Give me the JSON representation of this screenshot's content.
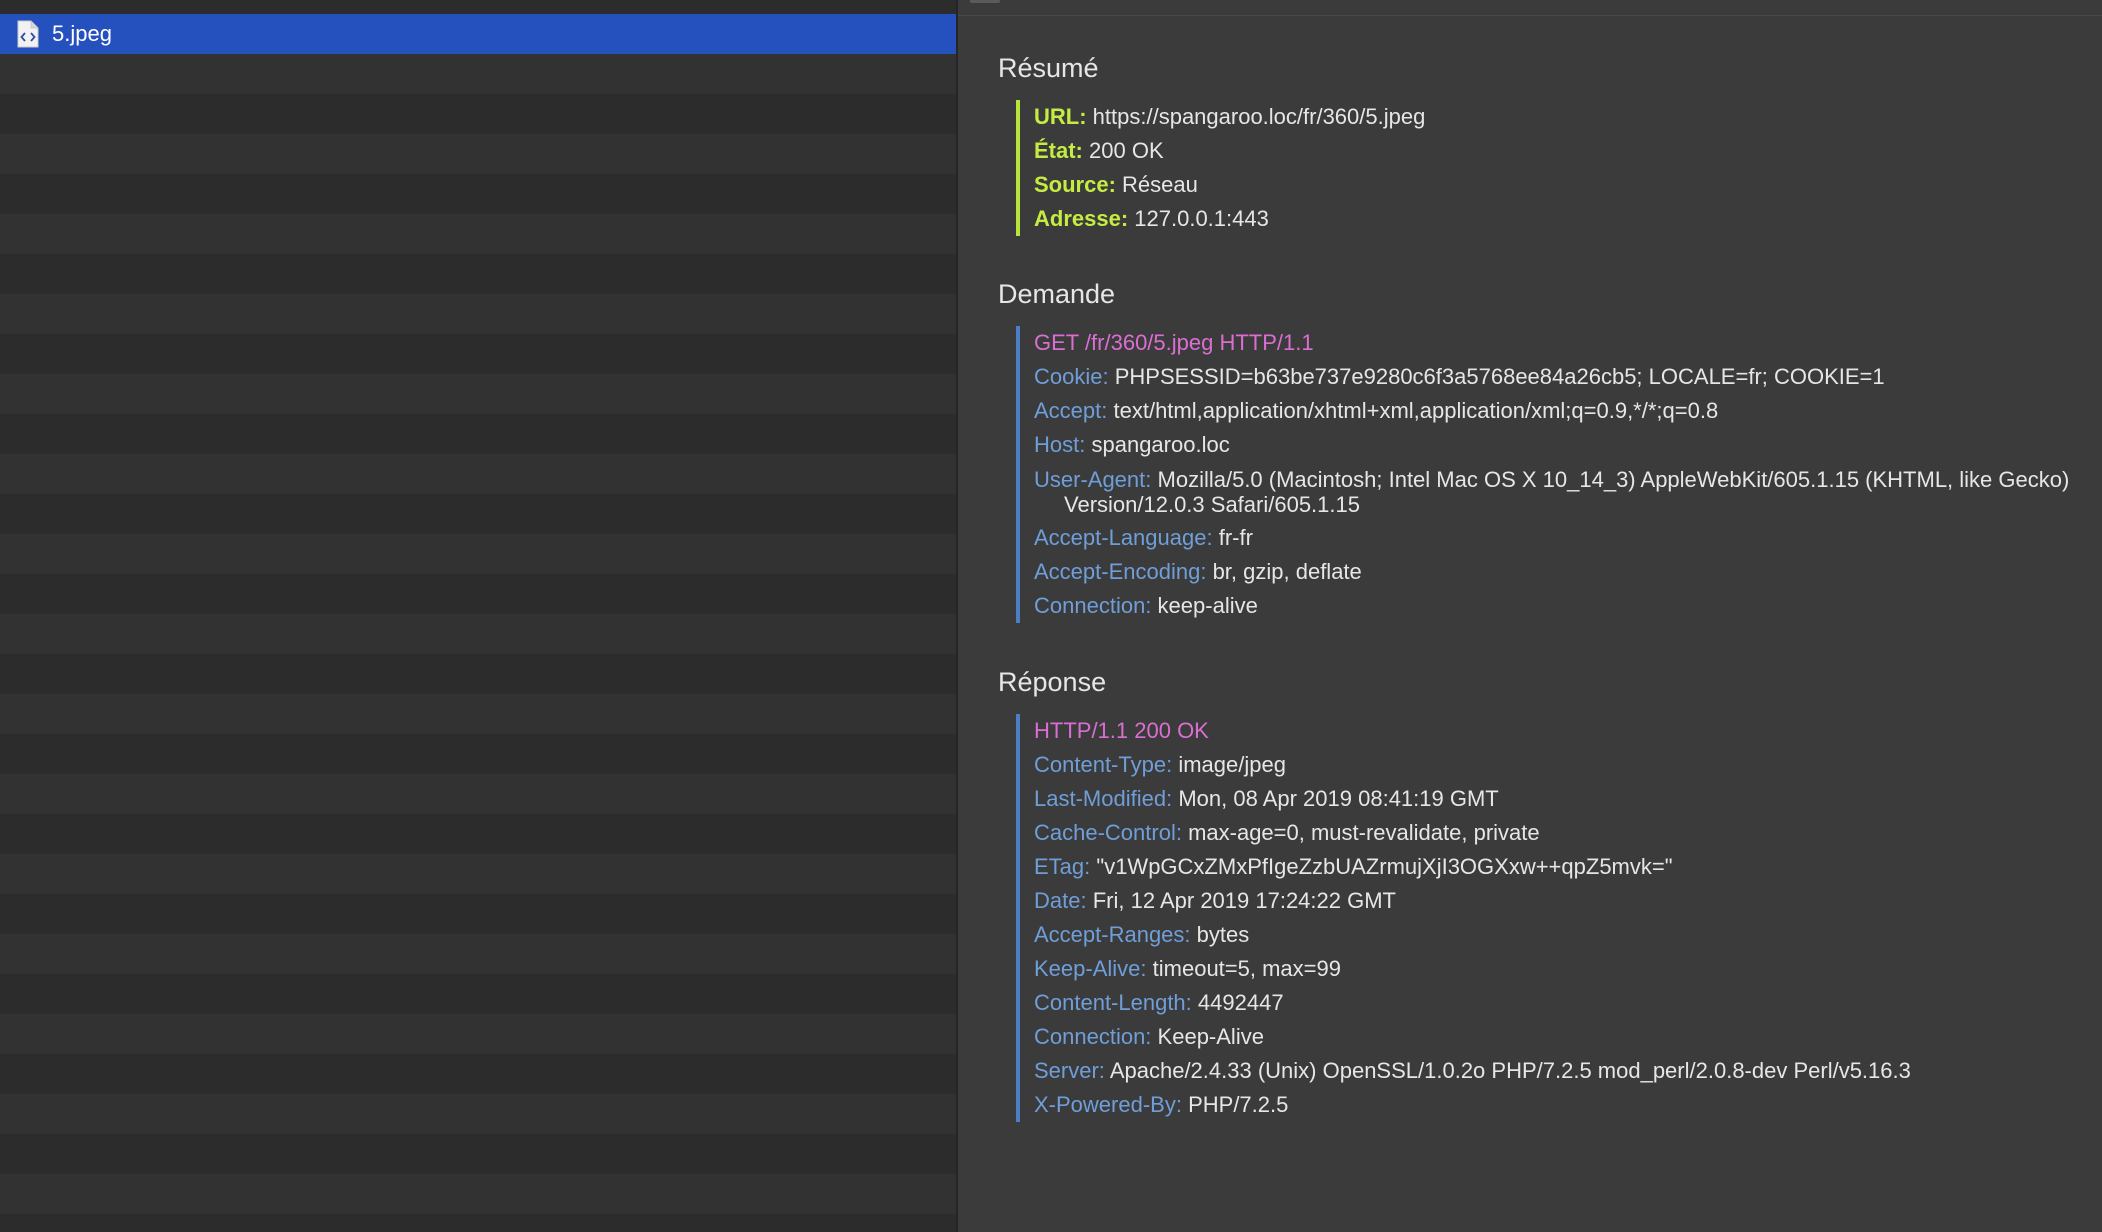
{
  "file_list": {
    "selected_file": "5.jpeg",
    "file_icon": "document-code-icon"
  },
  "summary": {
    "title": "Résumé",
    "items": [
      {
        "key": "URL:",
        "value": "https://spangaroo.loc/fr/360/5.jpeg"
      },
      {
        "key": "État:",
        "value": "200 OK"
      },
      {
        "key": "Source:",
        "value": "Réseau"
      },
      {
        "key": "Adresse:",
        "value": "127.0.0.1:443"
      }
    ]
  },
  "request": {
    "title": "Demande",
    "request_line": "GET /fr/360/5.jpeg HTTP/1.1",
    "headers": [
      {
        "key": "Cookie:",
        "value": "PHPSESSID=b63be737e9280c6f3a5768ee84a26cb5; LOCALE=fr; COOKIE=1"
      },
      {
        "key": "Accept:",
        "value": "text/html,application/xhtml+xml,application/xml;q=0.9,*/*;q=0.8"
      },
      {
        "key": "Host:",
        "value": "spangaroo.loc"
      },
      {
        "key": "User-Agent:",
        "value": "Mozilla/5.0 (Macintosh; Intel Mac OS X 10_14_3) AppleWebKit/605.1.15 (KHTML, like Gecko) Version/12.0.3 Safari/605.1.15"
      },
      {
        "key": "Accept-Language:",
        "value": "fr-fr"
      },
      {
        "key": "Accept-Encoding:",
        "value": "br, gzip, deflate"
      },
      {
        "key": "Connection:",
        "value": "keep-alive"
      }
    ]
  },
  "response": {
    "title": "Réponse",
    "status_line": "HTTP/1.1 200 OK",
    "headers": [
      {
        "key": "Content-Type:",
        "value": "image/jpeg"
      },
      {
        "key": "Last-Modified:",
        "value": "Mon, 08 Apr 2019 08:41:19 GMT"
      },
      {
        "key": "Cache-Control:",
        "value": "max-age=0, must-revalidate, private"
      },
      {
        "key": "ETag:",
        "value": "\"v1WpGCxZMxPfIgeZzbUAZrmujXjI3OGXxw++qpZ5mvk=\""
      },
      {
        "key": "Date:",
        "value": "Fri, 12 Apr 2019 17:24:22 GMT"
      },
      {
        "key": "Accept-Ranges:",
        "value": "bytes"
      },
      {
        "key": "Keep-Alive:",
        "value": "timeout=5, max=99"
      },
      {
        "key": "Content-Length:",
        "value": "4492447"
      },
      {
        "key": "Connection:",
        "value": "Keep-Alive"
      },
      {
        "key": "Server:",
        "value": "Apache/2.4.33 (Unix) OpenSSL/1.0.2o PHP/7.2.5 mod_perl/2.0.8-dev Perl/v5.16.3"
      },
      {
        "key": "X-Powered-By:",
        "value": "PHP/7.2.5"
      }
    ]
  },
  "colors": {
    "selection": "#2551bf",
    "summary_key": "#c5ec43",
    "summary_bar": "#b9e33d",
    "header_key": "#6f9ed8",
    "header_bar": "#4b7ec4",
    "status_line": "#db6ed2",
    "text": "#e6e6e6"
  }
}
